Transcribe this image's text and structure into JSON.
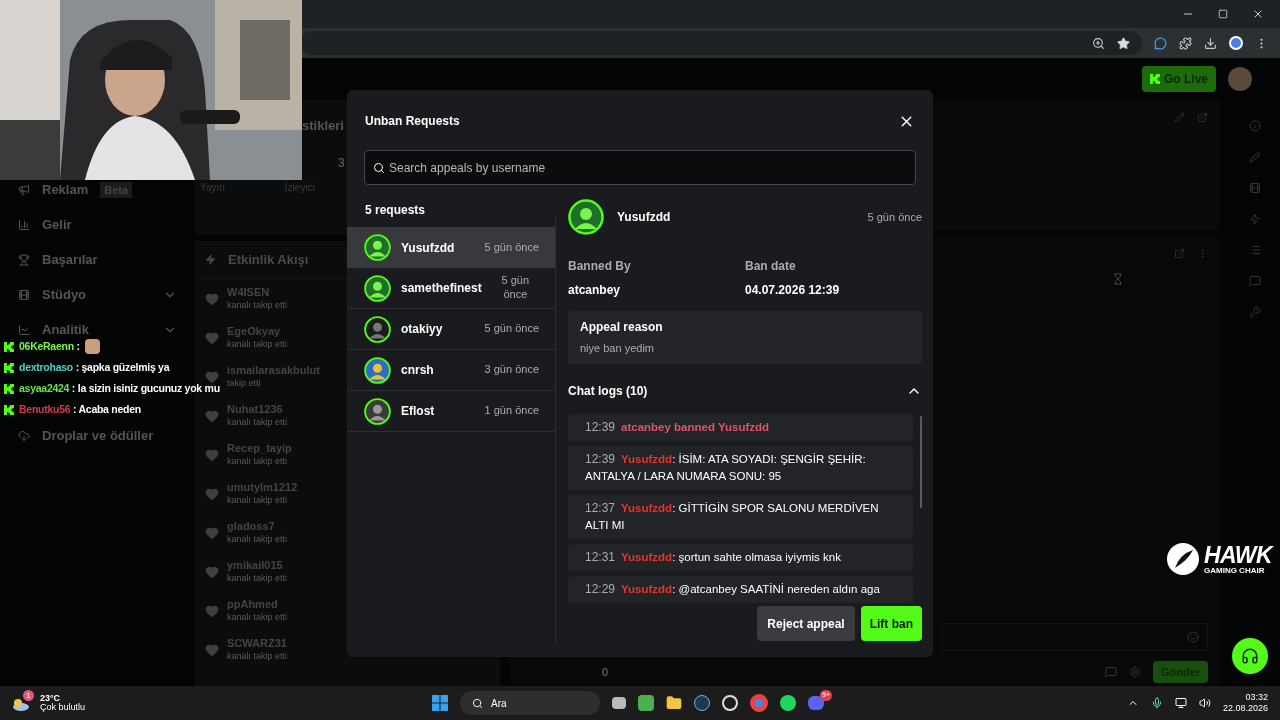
{
  "dashboard": {
    "partial_title": "stikleri",
    "stat_digit": "3",
    "stat_labels": [
      "Yayın",
      "İzleyici"
    ],
    "go_live": "Go Live",
    "sidebar": [
      {
        "label": "Reklam",
        "badge": "Beta",
        "expandable": false
      },
      {
        "label": "Gelir",
        "expandable": false
      },
      {
        "label": "Başarılar",
        "expandable": false
      },
      {
        "label": "Stüdyo",
        "expandable": true
      },
      {
        "label": "Analitik",
        "expandable": true
      },
      {
        "label": "Droplar ve ödüller",
        "expandable": false
      }
    ],
    "activity_feed": {
      "title": "Etkinlik Akışı",
      "events": [
        {
          "user": "W4ISEN",
          "action": "kanalı takip etti"
        },
        {
          "user": "EgeOkyay",
          "action": "kanalı takip etti"
        },
        {
          "user": "ismailarasakbulut",
          "action": "takip etti"
        },
        {
          "user": "Nuhat1236",
          "action": "kanalı takip etti"
        },
        {
          "user": "Recep_tayip",
          "action": "kanalı takip etti"
        },
        {
          "user": "umutylm1212",
          "action": "kanalı takip etti"
        },
        {
          "user": "gladoss7",
          "action": "kanalı takip etti"
        },
        {
          "user": "ymikail015",
          "action": "kanalı takip etti"
        },
        {
          "user": "ppAhmed",
          "action": "kanalı takip etti"
        },
        {
          "user": "SCWARZ31",
          "action": "kanalı takip etti"
        }
      ]
    },
    "viewer_count": "0",
    "send_button": "Gönder"
  },
  "stream_chat": [
    {
      "user": "06KeRaenn",
      "color": "#7cf54a",
      "message": " :",
      "emote": true
    },
    {
      "user": "dextrohaso",
      "color": "#4fd1c5",
      "message": " : şapka güzelmiş ya",
      "emote": false
    },
    {
      "user": "asyaa2424",
      "color": "#6be046",
      "message": " : la sizin isiniz gucunuz yok mu",
      "emote": false
    },
    {
      "user": "Benutku56",
      "color": "#d33a4a",
      "message": " : Acaba neden",
      "emote": false
    }
  ],
  "modal": {
    "title": "Unban Requests",
    "search_placeholder": "Search appeals by username",
    "count": "5 requests",
    "requests": [
      {
        "user": "Yusufzdd",
        "time": "5 gün önce",
        "selected": true
      },
      {
        "user": "samethefinest",
        "time": "5 gün önce",
        "selected": false
      },
      {
        "user": "otakiyy",
        "time": "5 gün önce",
        "selected": false
      },
      {
        "user": "cnrsh",
        "time": "3 gün önce",
        "selected": false
      },
      {
        "user": "Eflost",
        "time": "1 gün önce",
        "selected": false
      }
    ],
    "detail": {
      "user": "Yusufzdd",
      "time": "5 gün önce",
      "banned_by_label": "Banned By",
      "banned_by": "atcanbey",
      "ban_date_label": "Ban date",
      "ban_date": "04.07.2026 12:39",
      "appeal_reason_label": "Appeal reason",
      "appeal_reason": "niye ban yedim",
      "chat_logs_title": "Chat logs (10)",
      "chat_logs_expanded": true,
      "logs": [
        {
          "time": "12:39",
          "kind": "system",
          "text": "atcanbey banned Yusufzdd"
        },
        {
          "time": "12:39",
          "kind": "message",
          "user": "Yusufzdd",
          "text": ": İSİM: ATA SOYADI: ŞENGİR ŞEHİR: ANTALYA / LARA NUMARA SONU: 95"
        },
        {
          "time": "12:37",
          "kind": "message",
          "user": "Yusufzdd",
          "text": ": GİTTİGİN SPOR SALONU MERDİVEN ALTI MI"
        },
        {
          "time": "12:31",
          "kind": "message",
          "user": "Yusufzdd",
          "text": ": şortun sahte olmasa iyiymis knk"
        },
        {
          "time": "12:29",
          "kind": "message",
          "user": "Yusufzdd",
          "text": ": @atcanbey SAATİNİ nereden aldın aga"
        }
      ]
    },
    "reject_button": "Reject appeal",
    "lift_button": "Lift ban"
  },
  "overlay_logo": {
    "name": "HAWK",
    "tagline": "GAMING CHAIR"
  },
  "taskbar": {
    "weather_badge": "1",
    "temperature": "23°C",
    "weather": "Çok bulutlu",
    "search": "Ara",
    "discord_badge": "9+",
    "time": "03:32",
    "date": "22.08.2026"
  }
}
